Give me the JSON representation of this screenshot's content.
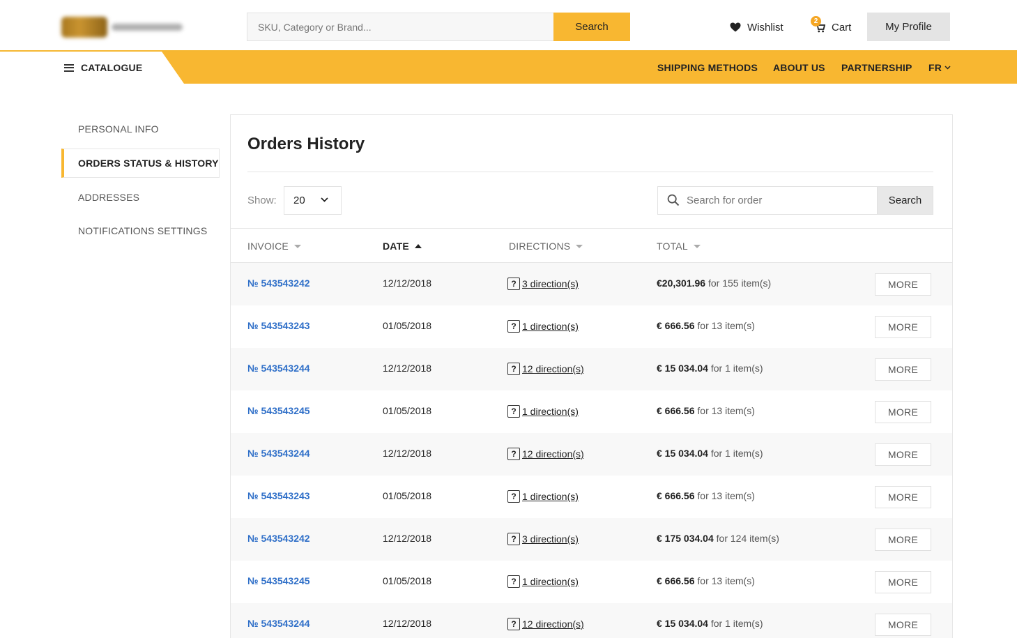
{
  "header": {
    "search_placeholder": "SKU, Category or Brand...",
    "search_button": "Search",
    "wishlist": "Wishlist",
    "cart": "Cart",
    "cart_count": "2",
    "profile": "My Profile"
  },
  "nav": {
    "catalogue": "CATALOGUE",
    "shipping": "SHIPPING METHODS",
    "about": "ABOUT US",
    "partnership": "PARTNERSHIP",
    "language": "FR"
  },
  "sidebar": {
    "items": [
      {
        "label": "PERSONAL INFO"
      },
      {
        "label": "ORDERS STATUS & HISTORY"
      },
      {
        "label": "ADDRESSES"
      },
      {
        "label": "NOTIFICATIONS SETTINGS"
      }
    ]
  },
  "main": {
    "title": "Orders History",
    "show_label": "Show:",
    "show_value": "20",
    "search_placeholder": "Search for order",
    "search_button": "Search",
    "columns": {
      "invoice": "INVOICE",
      "date": "DATE",
      "directions": "DIRECTIONS",
      "total": "TOTAL"
    },
    "more_label": "MORE",
    "rows": [
      {
        "invoice": "№ 543543242",
        "date": "12/12/2018",
        "directions": "3 direction(s)",
        "total": "€20,301.96",
        "items": "for 155 item(s)"
      },
      {
        "invoice": "№ 543543243",
        "date": "01/05/2018",
        "directions": "1 direction(s)",
        "total": "€ 666.56",
        "items": "for 13 item(s)"
      },
      {
        "invoice": "№ 543543244",
        "date": "12/12/2018",
        "directions": "12 direction(s)",
        "total": "€ 15 034.04",
        "items": "for 1 item(s)"
      },
      {
        "invoice": "№ 543543245",
        "date": "01/05/2018",
        "directions": "1 direction(s)",
        "total": "€ 666.56",
        "items": "for 13 item(s)"
      },
      {
        "invoice": "№ 543543244",
        "date": "12/12/2018",
        "directions": "12 direction(s)",
        "total": "€ 15 034.04",
        "items": "for 1 item(s)"
      },
      {
        "invoice": "№ 543543243",
        "date": "01/05/2018",
        "directions": "1 direction(s)",
        "total": "€ 666.56",
        "items": "for 13 item(s)"
      },
      {
        "invoice": "№ 543543242",
        "date": "12/12/2018",
        "directions": "3 direction(s)",
        "total": "€ 175 034.04",
        "items": "for 124 item(s)"
      },
      {
        "invoice": "№ 543543245",
        "date": "01/05/2018",
        "directions": "1 direction(s)",
        "total": "€ 666.56",
        "items": "for 13 item(s)"
      },
      {
        "invoice": "№ 543543244",
        "date": "12/12/2018",
        "directions": "12 direction(s)",
        "total": "€ 15 034.04",
        "items": "for 1 item(s)"
      }
    ]
  },
  "colors": {
    "accent": "#f8b731",
    "link": "#2f6fc8"
  },
  "icons": [
    "menu-icon",
    "heart-icon",
    "cart-icon",
    "chevron-down-icon",
    "search-icon",
    "sort-down-icon",
    "sort-up-icon",
    "question-icon"
  ]
}
